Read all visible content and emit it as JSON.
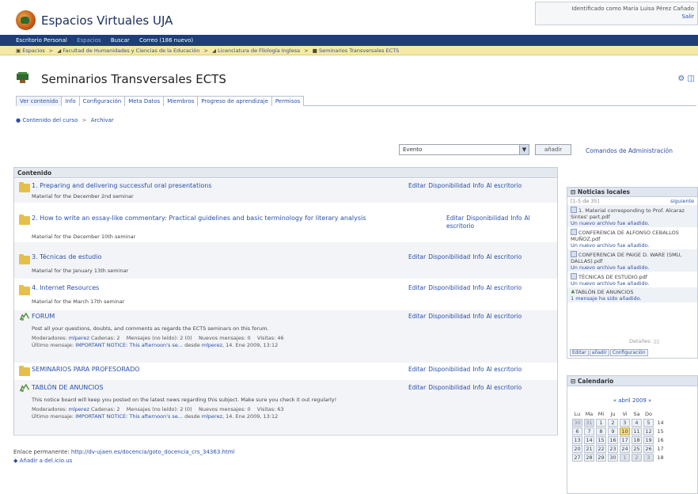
{
  "header": {
    "app_title": "Espacios Virtuales UJA",
    "user_text": "Identificado como Maria Luisa Pérez Cañado",
    "logout": "Salir"
  },
  "topnav": [
    "Escritorio Personal",
    "Espacios",
    "Buscar",
    "Correo (186 nuevo)"
  ],
  "breadcrumb": [
    "Espacios",
    "Facultad de Humanidades y Ciencias de la Educación",
    "Licenciatura de Filología Inglesa",
    "Seminarios Transversales ECTS"
  ],
  "page": {
    "title": "Seminarios Transversales ECTS"
  },
  "tabs": [
    "Ver contenido",
    "Info",
    "Configuración",
    "Meta Datos",
    "Miembros",
    "Progreso de aprendizaje",
    "Permisos"
  ],
  "subnav": {
    "content": "Contenido del curso",
    "archive": "Archivar"
  },
  "toolbar": {
    "select_value": "Evento",
    "add_label": "añadir",
    "admin_label": "Comandos de Administración"
  },
  "content": {
    "header": "Contenido",
    "actions": [
      "Editar",
      "Disponibilidad",
      "Info",
      "Al escritorio"
    ],
    "rows": [
      {
        "title": "1. Preparing and delivering successful oral presentations",
        "desc": "Material for the December 2nd seminar"
      },
      {
        "title": "2. How to write an essay-like commentary: Practical guidelines and basic terminology for literary analysis",
        "desc": "Material for the December 10th seminar"
      },
      {
        "title": "3. Técnicas de estudio",
        "desc": "Material for the January 13th seminar"
      },
      {
        "title": "4. Internet Resources",
        "desc": "Material for the March 17th seminar"
      },
      {
        "title": "FORUM",
        "desc": "Post all your questions, doubts, and comments as regards the ECTS seminars on this forum.",
        "meta1_label": "Moderadores:",
        "meta1_link": "mlperez",
        "meta1_rest": "Cadenas: 2    Mensajes (no leído): 2 (0)    Nuevos mensajes: 0    Visitas: 46",
        "meta2_label": "Último mensaje:",
        "meta2_link": "IMPORTANT NOTICE: This afternoon's se...",
        "meta2_rest": "desde",
        "meta2_user": "mlperez",
        "meta2_date": ", 14. Ene 2009, 13:12"
      },
      {
        "title": "SEMINARIOS PARA PROFESORADO",
        "desc": ""
      },
      {
        "title": "TABLÓN DE ANUNCIOS",
        "desc": "This notice board will keep you posted on the latest news regarding this subject. Make sure you check it out regularly!",
        "meta1_label": "Moderadores:",
        "meta1_link": "mlperez",
        "meta1_rest": "Cadenas: 2    Mensajes (no leído): 2 (0)    Nuevos mensajes: 0    Visitas: 63",
        "meta2_label": "Último mensaje:",
        "meta2_link": "IMPORTANT NOTICE: This afternoon's se...",
        "meta2_rest": "desde",
        "meta2_user": "mlperez",
        "meta2_date": ", 14. Ene 2009, 13:12"
      }
    ]
  },
  "footer": {
    "permalink_label": "Enlace permanente:",
    "permalink_url": "http://dv-ujaen.es/docencia/goto_docencia_crs_34363.html",
    "bookmark": "Añadir a del.icio.us"
  },
  "news": {
    "header": "Noticias locales",
    "range": "[1-5 de 35]",
    "next": "siguiente",
    "items": [
      {
        "title": "1. Material corresponding to Prof. Alcaraz Sintes' part.pdf",
        "sub": "Un nuevo archivo fue añadido."
      },
      {
        "title": "CONFERENCIA DE ALFONSO CEBALLOS MUÑOZ.pdf",
        "sub": "Un nuevo archivo fue añadido."
      },
      {
        "title": "CONFERENCIA DE PAIGE D. WARE (SMU, DALLAS).pdf",
        "sub": "Un nuevo archivo fue añadido."
      },
      {
        "title": "TÉCNICAS DE ESTUDIO.pdf",
        "sub": "Un nuevo archivo fue añadido."
      },
      {
        "title": "TABLÓN DE ANUNCIOS",
        "sub": "1 mensaje ha sido añadido."
      }
    ],
    "detail": "Detalles:",
    "buttons": [
      "Editar",
      "añadir",
      "Configuración"
    ]
  },
  "calendar": {
    "header": "Calendario",
    "month": "« abril 2009 »",
    "weekdays": [
      "Lu",
      "Ma",
      "Mi",
      "Ju",
      "Vi",
      "Sa",
      "Do"
    ],
    "weeks": [
      [
        "30",
        "31",
        "1",
        "2",
        "3",
        "4",
        "5"
      ],
      [
        "6",
        "7",
        "8",
        "9",
        "10",
        "11",
        "12"
      ],
      [
        "13",
        "14",
        "15",
        "16",
        "17",
        "18",
        "19"
      ],
      [
        "20",
        "21",
        "22",
        "23",
        "24",
        "25",
        "26"
      ],
      [
        "27",
        "28",
        "29",
        "30",
        "1",
        "2",
        "3"
      ]
    ],
    "week_numbers": [
      "14",
      "15",
      "16",
      "17",
      "18"
    ],
    "today": "10"
  }
}
